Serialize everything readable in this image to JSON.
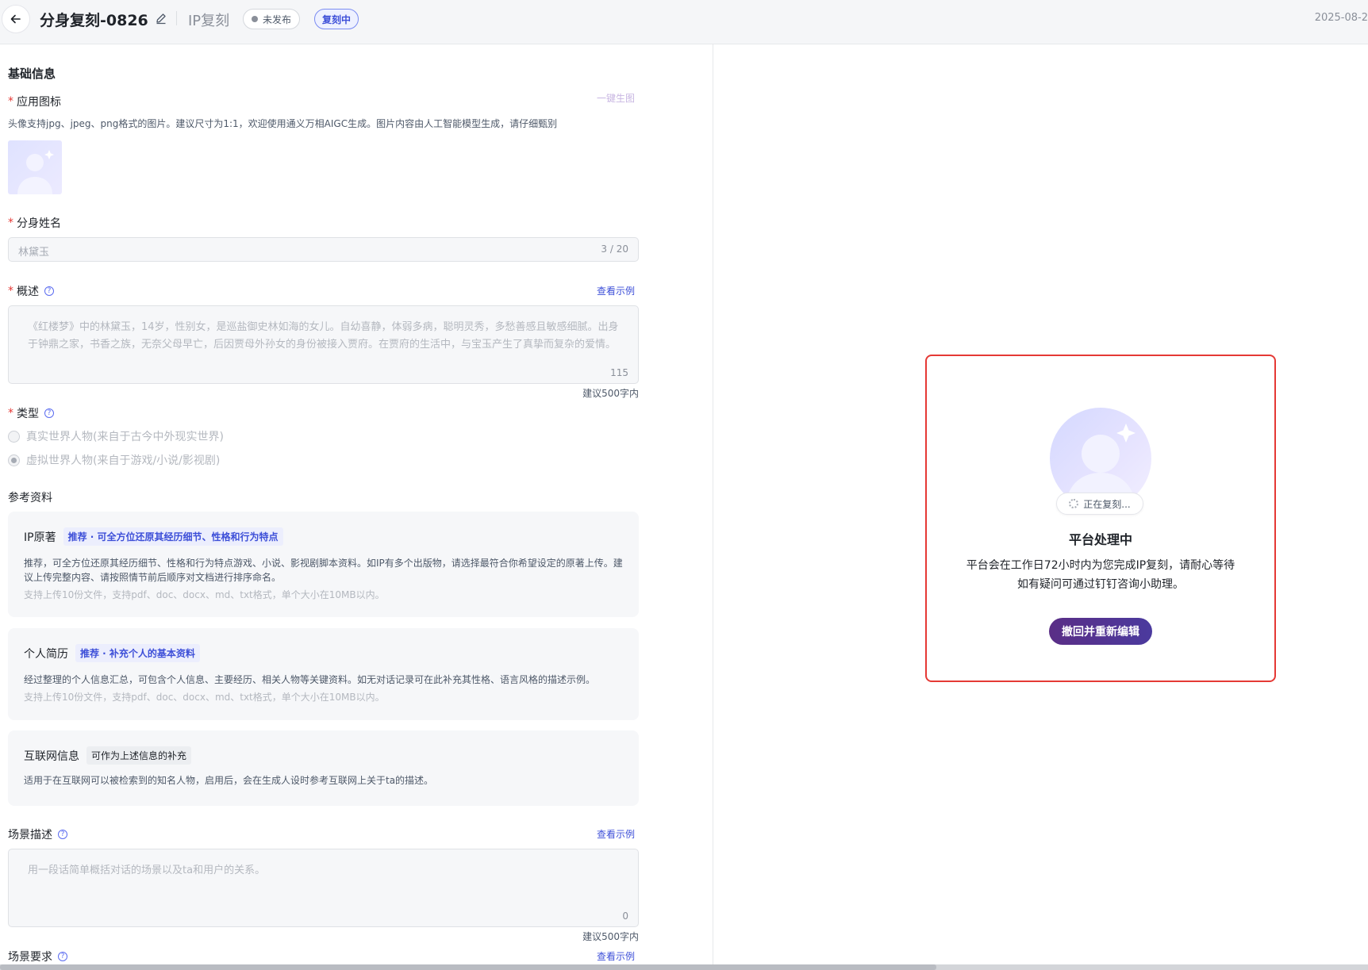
{
  "header": {
    "title": "分身复刻-0826",
    "ip_label": "IP复刻",
    "badge_unpublished": "未发布",
    "badge_copying": "复刻中",
    "date": "2025-08-2"
  },
  "form": {
    "section_basic": "基础信息",
    "app_icon": {
      "label": "应用图标",
      "generate_link": "一键生图",
      "hint": "头像支持jpg、jpeg、png格式的图片。建议尺寸为1:1，欢迎使用通义万相AIGC生成。图片内容由人工智能模型生成，请仔细甄别"
    },
    "name": {
      "label": "分身姓名",
      "value": "林黛玉",
      "count": "3 / 20"
    },
    "summary": {
      "label": "概述",
      "example_link": "查看示例",
      "text": "《红楼梦》中的林黛玉，14岁，性别女，是巡盐御史林如海的女儿。自幼喜静，体弱多病，聪明灵秀，多愁善感且敏感细腻。出身于钟鼎之家，书香之族，无奈父母早亡，后因贾母外孙女的身份被接入贾府。在贾府的生活中，与宝玉产生了真挚而复杂的爱情。",
      "count": "115",
      "suggest": "建议500字内"
    },
    "type": {
      "label": "类型",
      "option_real": "真实世界人物(来自于古今中外现实世界)",
      "option_virtual": "虚拟世界人物(来自于游戏/小说/影视剧)"
    },
    "section_reference": "参考资料",
    "ref_ip": {
      "title": "IP原著",
      "tag": "推荐 · 可全方位还原其经历细节、性格和行为特点",
      "desc": "推荐，可全方位还原其经历细节、性格和行为特点游戏、小说、影视剧脚本资料。如IP有多个出版物，请选择最符合你希望设定的原著上传。建议上传完整内容、请按照情节前后顺序对文档进行排序命名。",
      "note": "支持上传10份文件，支持pdf、doc、docx、md、txt格式，单个大小在10MB以内。"
    },
    "ref_resume": {
      "title": "个人简历",
      "tag": "推荐 · 补充个人的基本资料",
      "desc": "经过整理的个人信息汇总，可包含个人信息、主要经历、相关人物等关键资料。如无对话记录可在此补充其性格、语言风格的描述示例。",
      "note": "支持上传10份文件，支持pdf、doc、docx、md、txt格式，单个大小在10MB以内。"
    },
    "ref_internet": {
      "title": "互联网信息",
      "tag": "可作为上述信息的补充",
      "desc": "适用于在互联网可以被检索到的知名人物，启用后，会在生成人设时参考互联网上关于ta的描述。"
    },
    "scene_desc": {
      "label": "场景描述",
      "example_link": "查看示例",
      "placeholder": "用一段话简单概括对话的场景以及ta和用户的关系。",
      "count": "0",
      "suggest": "建议500字内"
    },
    "scene_req": {
      "label": "场景要求",
      "example_link": "查看示例"
    }
  },
  "status_card": {
    "copying_label": "正在复刻...",
    "title": "平台处理中",
    "line1": "平台会在工作日72小时内为您完成IP复刻，请耐心等待",
    "line2": "如有疑问可通过钉钉咨询小助理。",
    "button": "撤回并重新编辑"
  },
  "colors": {
    "accent": "#3d4fd8",
    "button": "#5a2e86",
    "highlight_border": "#e53935"
  }
}
